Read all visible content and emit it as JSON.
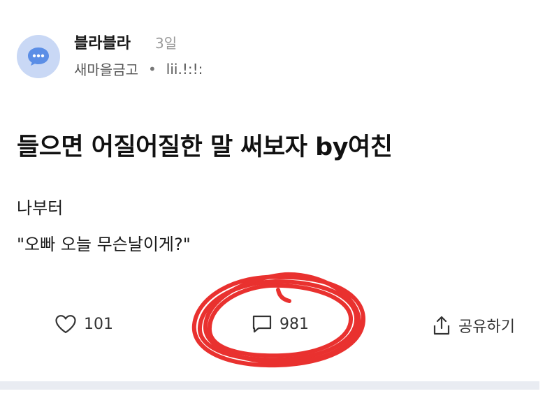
{
  "author": {
    "name": "블라블라",
    "age": "3일",
    "company": "새마을금고",
    "separator": "•",
    "nickname": "lii.!:!:",
    "avatar_icon": "chat-bubble-icon"
  },
  "post": {
    "title": "들으면 어질어질한 말 써보자 by여친",
    "body": [
      "나부터",
      "\"오빠 오늘 무슨날이게?\""
    ]
  },
  "actions": {
    "like": {
      "icon": "heart-icon",
      "count": "101"
    },
    "comment": {
      "icon": "comment-icon",
      "count": "981"
    },
    "share": {
      "icon": "share-icon",
      "label": "공유하기"
    }
  },
  "annotation": {
    "color": "#e8201e",
    "shape": "hand-drawn-circle"
  }
}
